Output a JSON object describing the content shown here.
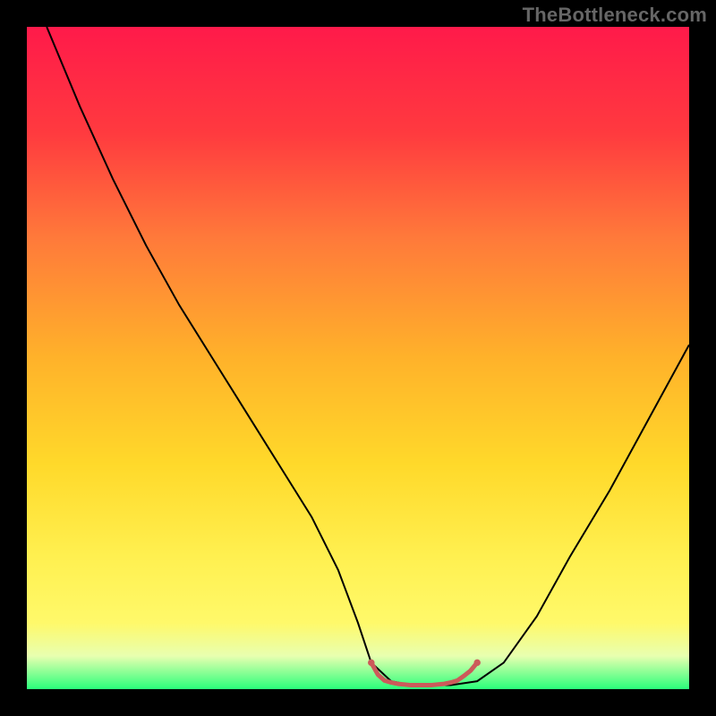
{
  "watermark": "TheBottleneck.com",
  "chart_data": {
    "type": "line",
    "title": "",
    "xlabel": "",
    "ylabel": "",
    "xlim": [
      0,
      100
    ],
    "ylim": [
      0,
      100
    ],
    "grid": false,
    "gradient_background": {
      "top": "#ff1a4a",
      "mid1": "#ff7a3a",
      "mid2": "#ffd92a",
      "mid3": "#fff96a",
      "bottom": "#2aff7a"
    },
    "series": [
      {
        "name": "bottleneck-curve",
        "type": "line",
        "color": "#000000",
        "x": [
          3,
          8,
          13,
          18,
          23,
          28,
          33,
          38,
          43,
          47,
          50,
          52,
          55,
          58,
          60,
          64,
          68,
          72,
          77,
          82,
          88,
          94,
          100
        ],
        "y": [
          100,
          88,
          77,
          67,
          58,
          50,
          42,
          34,
          26,
          18,
          10,
          4,
          1.2,
          0.6,
          0.6,
          0.6,
          1.2,
          4,
          11,
          20,
          30,
          41,
          52
        ]
      },
      {
        "name": "optimal-marker",
        "type": "line",
        "color": "#cc5a5a",
        "stroke_width": 5,
        "linecap": "round",
        "x": [
          52,
          53,
          54,
          55,
          56,
          57,
          58,
          59,
          60,
          61,
          62,
          63,
          64,
          65,
          66,
          67,
          68
        ],
        "y": [
          4,
          2.2,
          1.3,
          1.0,
          0.8,
          0.7,
          0.6,
          0.6,
          0.6,
          0.6,
          0.7,
          0.8,
          1.0,
          1.3,
          2.0,
          2.8,
          4
        ]
      }
    ]
  }
}
